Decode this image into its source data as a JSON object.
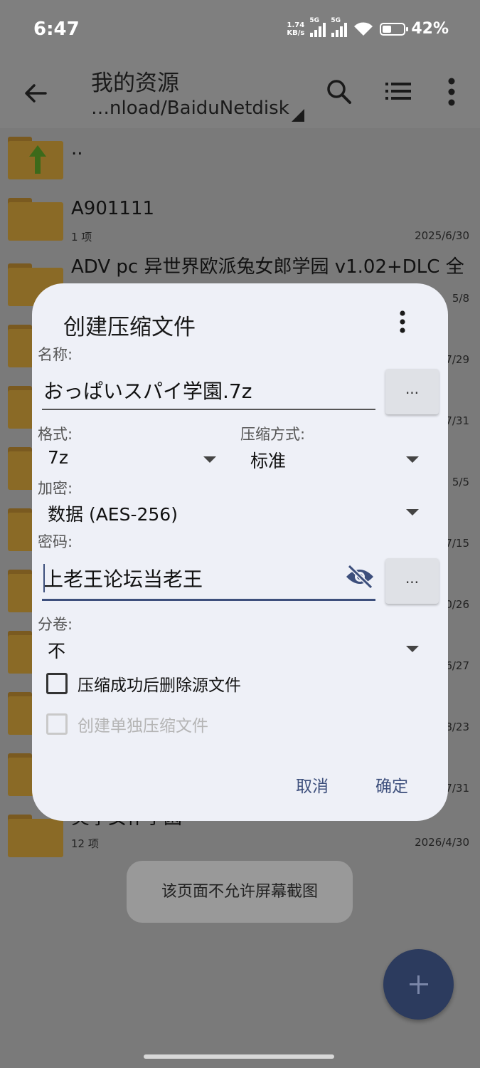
{
  "status": {
    "time": "6:47",
    "net_speed_value": "1.74",
    "net_speed_unit": "KB/s",
    "sim1": "5G",
    "sim2": "5G",
    "battery_pct": "42%",
    "battery_level": 0.42
  },
  "toolbar": {
    "title": "我的资源",
    "path": "…nload/BaiduNetdisk"
  },
  "files": [
    {
      "name": "..",
      "meta": "",
      "date": ""
    },
    {
      "name": "A901111",
      "meta": "1 项",
      "date": "2025/6/30"
    },
    {
      "name": "ADV pc 异世界欧派兔女郎学园 v1.02+DLC 全",
      "meta": "",
      "date": "5/8"
    },
    {
      "name": "",
      "meta": "",
      "date": "7/29"
    },
    {
      "name": "",
      "meta": "",
      "date": "7/31"
    },
    {
      "name": "",
      "meta": "",
      "date": "5/5"
    },
    {
      "name": "",
      "meta": "",
      "date": "7/15"
    },
    {
      "name": "",
      "meta": "",
      "date": "0/26"
    },
    {
      "name": "",
      "meta": "",
      "date": "6/27"
    },
    {
      "name": "",
      "meta": "",
      "date": "8/23"
    },
    {
      "name": "",
      "meta": "",
      "date": "7/31"
    },
    {
      "name": "炎孕女仆学園",
      "meta": "12 项",
      "date": "2026/4/30"
    }
  ],
  "dialog": {
    "title": "创建压缩文件",
    "name_label": "名称:",
    "name_value": "おっぱいスパイ学園.7z",
    "ellipsis": "...",
    "format_label": "格式:",
    "format_value": "7z",
    "method_label": "压缩方式:",
    "method_value": "标准",
    "encrypt_label": "加密:",
    "encrypt_value": "数据 (AES-256)",
    "password_label": "密码:",
    "password_value": "上老王论坛当老王",
    "volume_label": "分卷:",
    "volume_value": "不",
    "delete_source_label": "压缩成功后删除源文件",
    "separate_label": "创建单独压缩文件",
    "cancel": "取消",
    "ok": "确定"
  },
  "toast": "该页面不允许屏幕截图",
  "colors": {
    "accent": "#3d4f7c",
    "fab": "#2c3b5e",
    "folder": "#8a6a26",
    "dialog_bg": "#eef0f7"
  }
}
